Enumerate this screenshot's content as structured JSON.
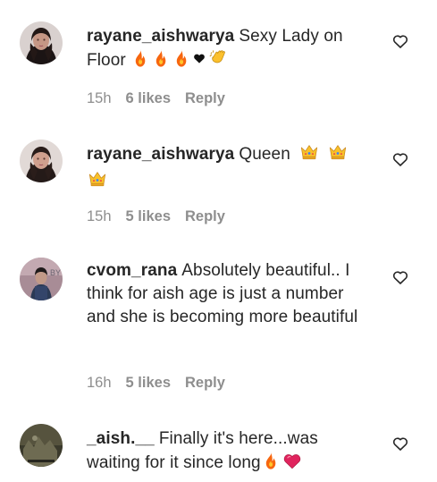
{
  "comments": [
    {
      "username": "rayane_aishwarya",
      "text": "Sexy Lady on Floor",
      "emoji": [
        "fire",
        "fire",
        "fire",
        "heart-black",
        "clapping-hands"
      ],
      "timestamp": "15h",
      "likes": "6 likes",
      "reply": "Reply"
    },
    {
      "username": "rayane_aishwarya",
      "text": "Queen",
      "emoji": [
        "crown",
        "crown",
        "crown"
      ],
      "timestamp": "15h",
      "likes": "5 likes",
      "reply": "Reply"
    },
    {
      "username": "cvom_rana",
      "text": "Absolutely beautiful.. I think for aish age is just a number and she is becoming more beautiful",
      "emoji": [],
      "timestamp": "16h",
      "likes": "5 likes",
      "reply": "Reply"
    },
    {
      "username": "_aish.__",
      "text": "Finally it's here...was waiting for it since long",
      "emoji": [
        "fire",
        "heart-red"
      ],
      "timestamp": "",
      "likes": "",
      "reply": ""
    }
  ]
}
